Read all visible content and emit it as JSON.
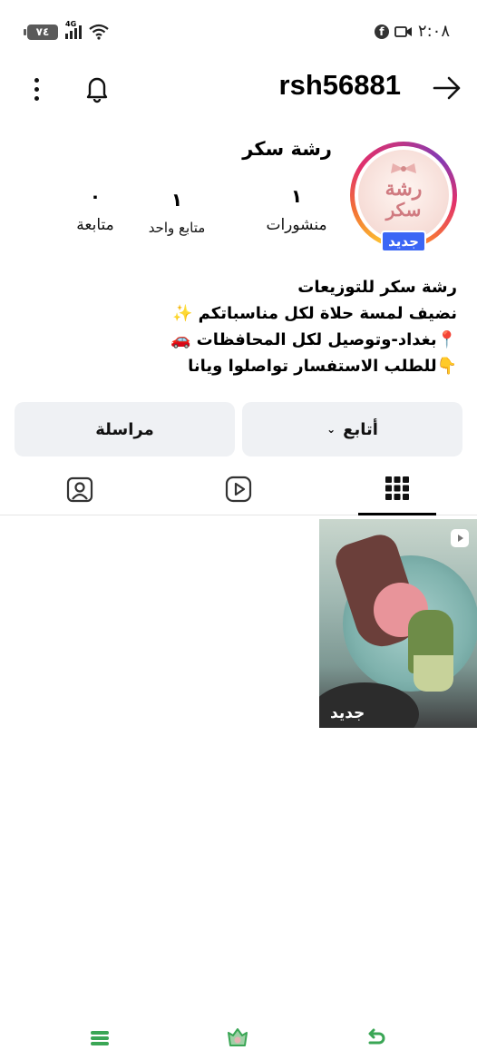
{
  "status_bar": {
    "time": "٢:٠٨",
    "battery": "٧٤",
    "network": "4G"
  },
  "header": {
    "username": "rsh56881"
  },
  "profile": {
    "display_name": "رشة سكر",
    "avatar_text_1": "رشة",
    "avatar_text_2": "سكر",
    "new_badge": "جديد",
    "stats": {
      "posts_count": "١",
      "posts_label": "منشورات",
      "followers_count": "١",
      "followers_label": "متابع واحد",
      "following_count": "٠",
      "following_label": "متابعة"
    },
    "bio": [
      "رشة سكر للتوزيعات",
      "نضيف لمسة حلاة لكل مناسباتكم ✨",
      "📍بغداد-وتوصيل لكل المحافظات 🚗",
      "👇للطلب الاستفسار تواصلوا ويانا"
    ]
  },
  "actions": {
    "follow_label": "أتابع",
    "message_label": "مراسلة"
  },
  "posts": [
    {
      "label": "جديد",
      "type": "reel"
    }
  ],
  "colors": {
    "accent_blue": "#3b66f5",
    "button_bg": "#eff1f4",
    "nav_green": "#3aa655"
  }
}
